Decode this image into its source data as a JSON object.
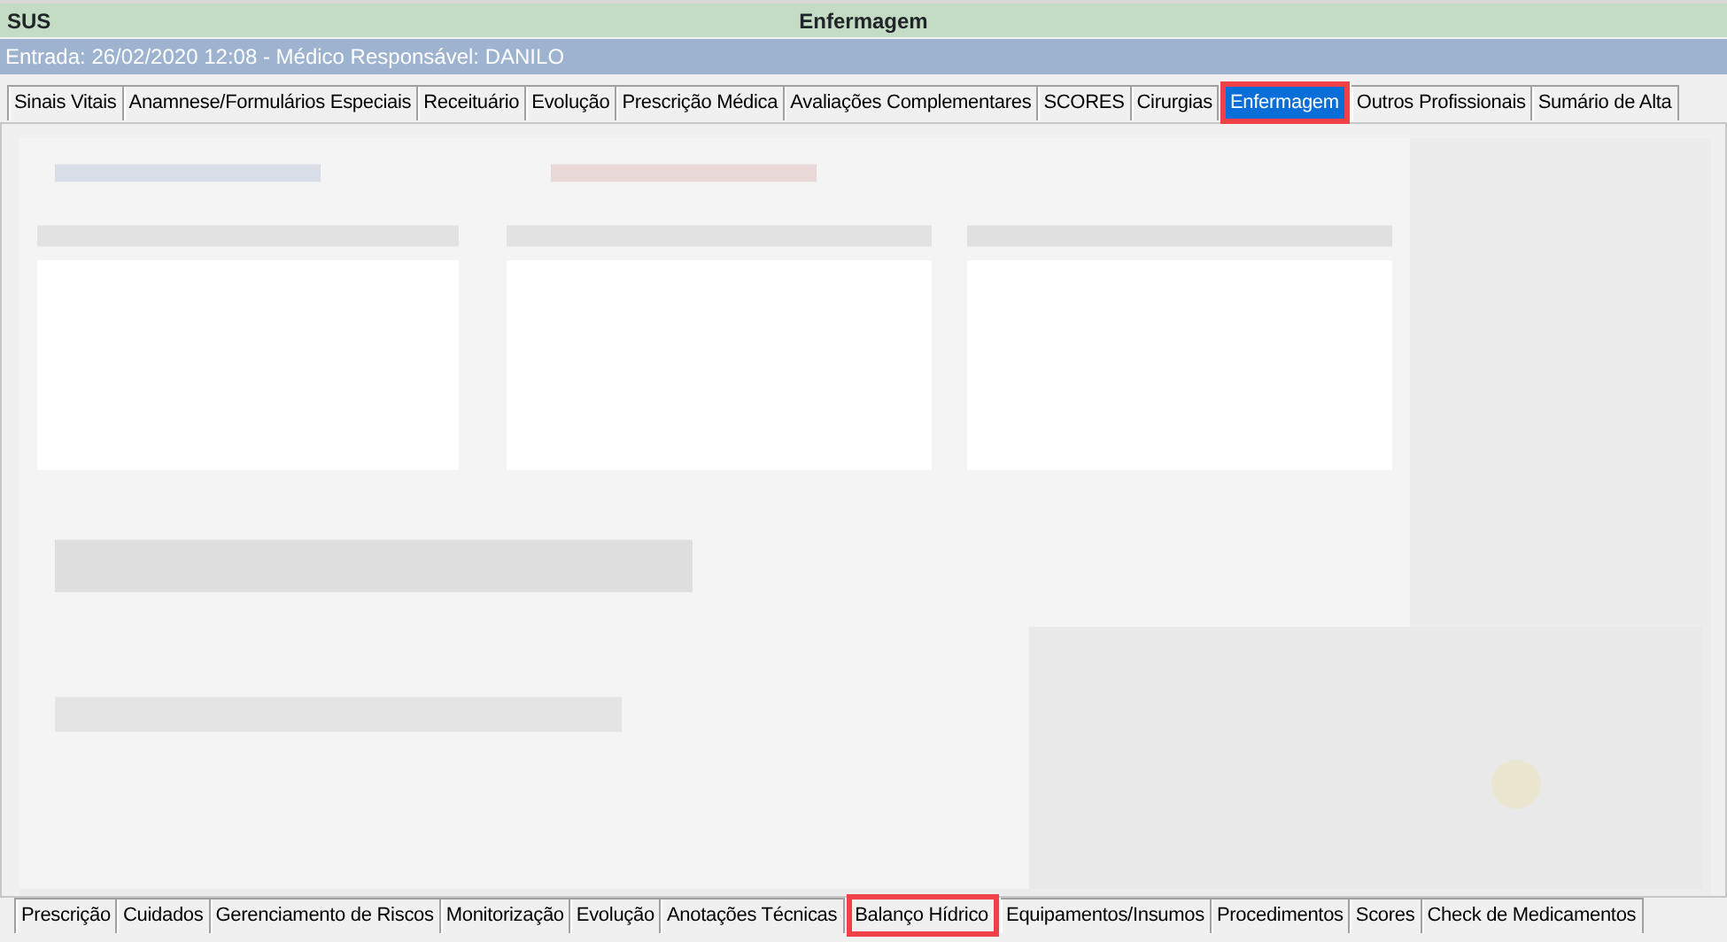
{
  "header": {
    "left": "SUS",
    "title": "Enfermagem"
  },
  "info_bar": "Entrada: 26/02/2020 12:08 - Médico Responsável: DANILO",
  "top_tabs": [
    {
      "label": "Sinais Vitais",
      "selected": false
    },
    {
      "label": "Anamnese/Formulários Especiais",
      "selected": false
    },
    {
      "label": "Receituário",
      "selected": false
    },
    {
      "label": "Evolução",
      "selected": false
    },
    {
      "label": "Prescrição Médica",
      "selected": false
    },
    {
      "label": "Avaliações Complementares",
      "selected": false
    },
    {
      "label": "SCORES",
      "selected": false
    },
    {
      "label": "Cirurgias",
      "selected": false
    },
    {
      "label": "Enfermagem",
      "selected": true
    },
    {
      "label": "Outros Profissionais",
      "selected": false
    },
    {
      "label": "Sumário de Alta",
      "selected": false
    }
  ],
  "bottom_tabs": [
    {
      "label": "Prescrição",
      "selected": false
    },
    {
      "label": "Cuidados",
      "selected": false
    },
    {
      "label": "Gerenciamento de Riscos",
      "selected": false
    },
    {
      "label": "Monitorização",
      "selected": false
    },
    {
      "label": "Evolução",
      "selected": false
    },
    {
      "label": "Anotações Técnicas",
      "selected": false
    },
    {
      "label": "Balanço Hídrico",
      "selected": true
    },
    {
      "label": "Equipamentos/Insumos",
      "selected": false
    },
    {
      "label": "Procedimentos",
      "selected": false
    },
    {
      "label": "Scores",
      "selected": false
    },
    {
      "label": "Check de Medicamentos",
      "selected": false
    }
  ]
}
